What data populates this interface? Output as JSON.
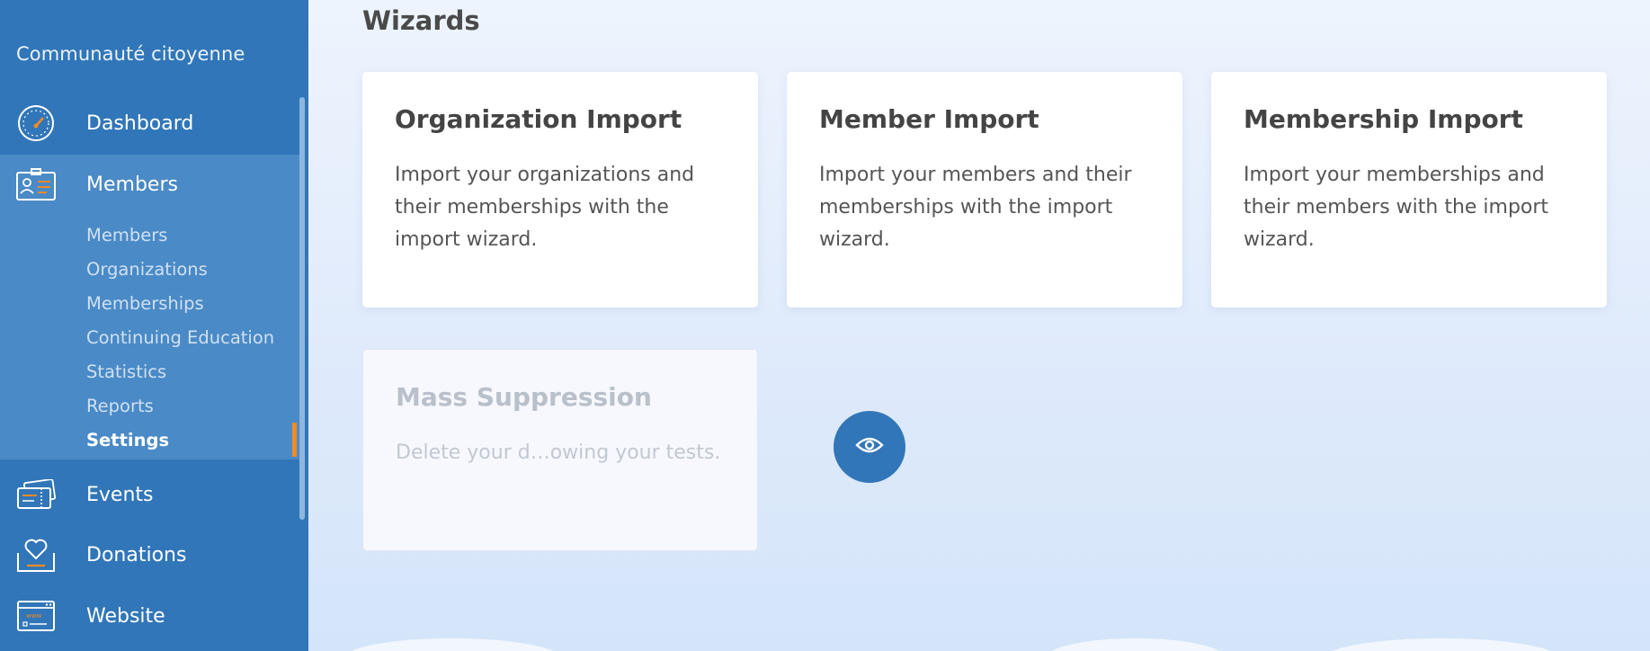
{
  "sidebar": {
    "org_name": "Communauté citoyenne",
    "items": [
      {
        "label": "Dashboard",
        "icon": "speedometer-icon"
      },
      {
        "label": "Members",
        "icon": "id-card-icon"
      },
      {
        "label": "Events",
        "icon": "tickets-icon"
      },
      {
        "label": "Donations",
        "icon": "heart-box-icon"
      },
      {
        "label": "Website",
        "icon": "browser-window-icon"
      }
    ],
    "members_submenu": [
      "Members",
      "Organizations",
      "Memberships",
      "Continuing Education",
      "Statistics",
      "Reports",
      "Settings"
    ],
    "current_submenu_item": "Settings"
  },
  "main": {
    "section_title": "Wizards",
    "cards": [
      {
        "title": "Organization Import",
        "description": "Import your organizations and their memberships with the import wizard."
      },
      {
        "title": "Member Import",
        "description": "Import your members and their memberships with the import wizard."
      },
      {
        "title": "Membership Import",
        "description": "Import your memberships and their members with the import wizard."
      },
      {
        "title": "Mass Suppression",
        "description": "Delete your d…owing your tests.",
        "disabled": true
      }
    ],
    "preview_icon": "eye-icon"
  },
  "colors": {
    "sidebar_bg": "#3176b8",
    "sidebar_active_bg": "#4a8ac6",
    "accent_orange": "#f08a24"
  }
}
